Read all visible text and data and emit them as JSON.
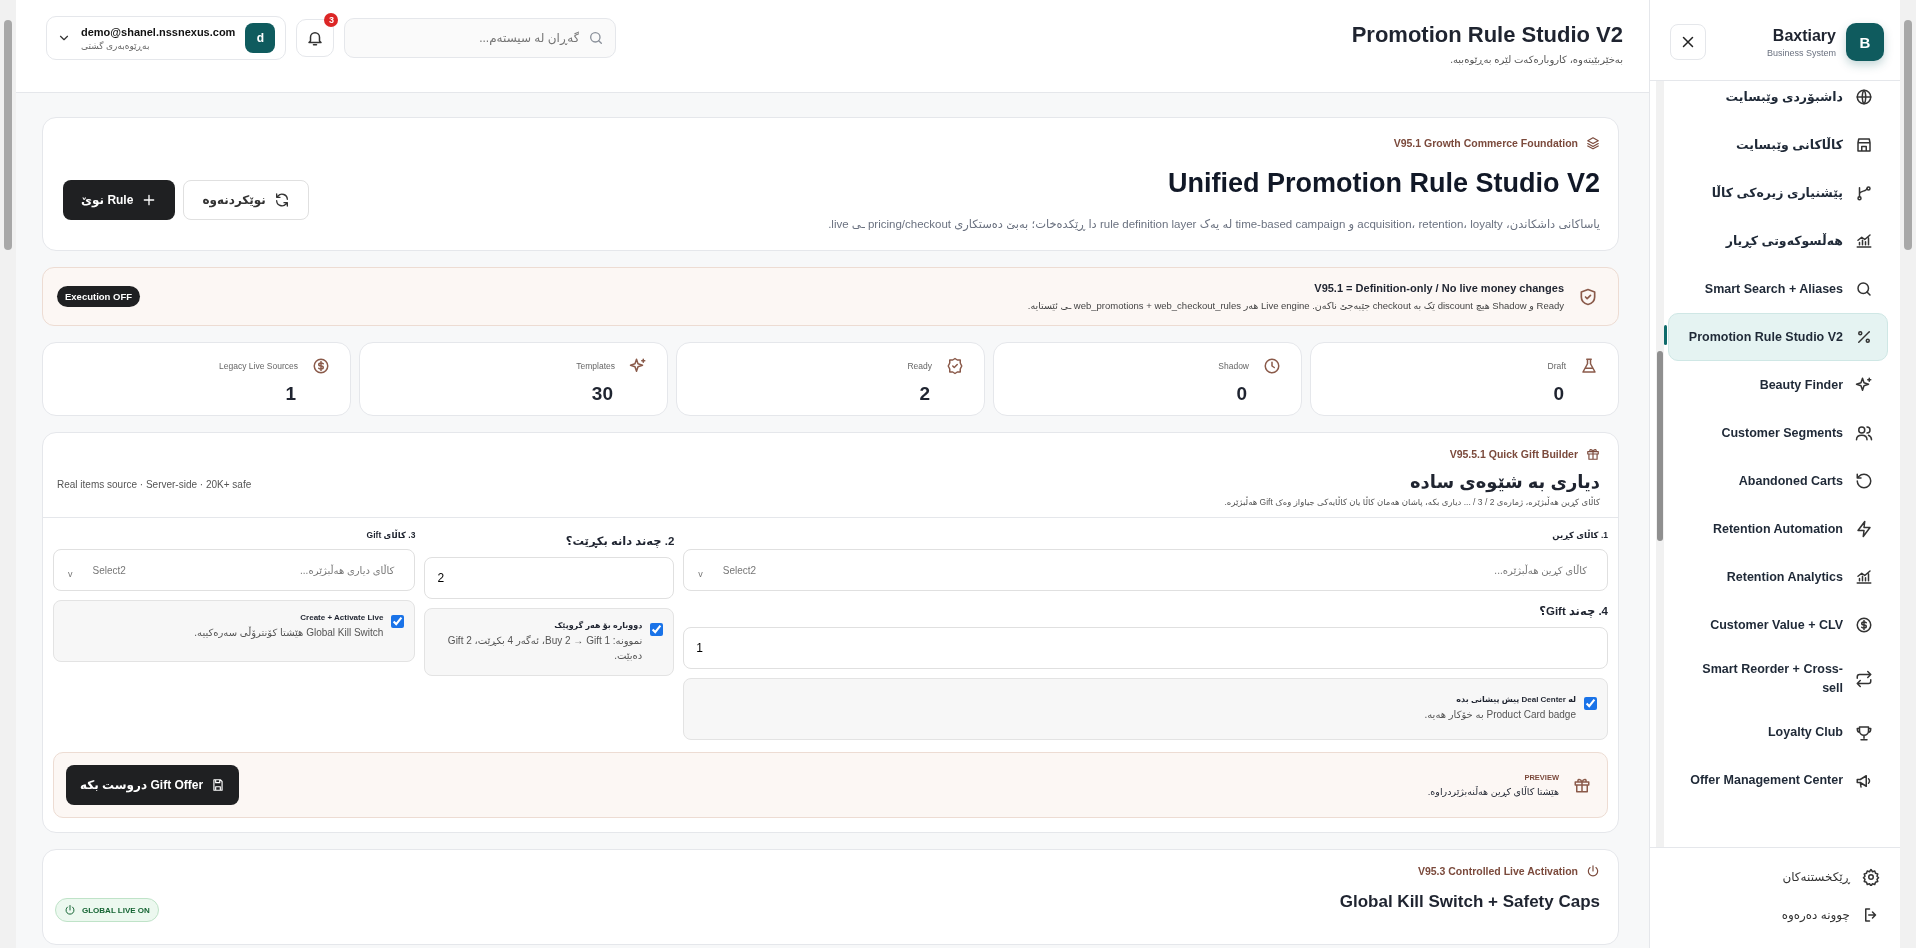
{
  "topbar": {
    "title": "Promotion Rule Studio V2",
    "subtitle": "بەخێربێیتەوە، کاروبارەکەت لێرە بەڕێوەببە.",
    "search": {
      "placeholder": "گەڕان لە سیستەم..."
    },
    "notifications": "3",
    "user": {
      "email": "demo@shanel.nssnexus.com",
      "role": "بەڕێوەبەری گشتی",
      "avatar": "d"
    }
  },
  "header": {
    "eyebrow": "V95.1 Growth Commerce Foundation",
    "title": "Unified Promotion Rule Studio V2",
    "description": "یاساکانی داشکاندن، acquisition، retention، loyalty و time-based campaign لە یەک rule definition layer دا ڕێکدەخات؛ بەبێ دەستکاری pricing/checkout ـی live.",
    "buttons": [
      {
        "label": "نوێکردنەوە",
        "kind": "secondary"
      },
      {
        "label": "Rule نوێ",
        "kind": "primary"
      }
    ]
  },
  "banner": {
    "title": "V95.1 = Definition-only / No live money changes",
    "text": "Ready و Shadow هیچ discount ێک بە checkout جێبەجێ ناکەن. Live engine هەر web_promotions + web_checkout_rules ـی ئێستایە.",
    "badge": "Execution OFF"
  },
  "stats": [
    {
      "label": "Draft",
      "value": "0"
    },
    {
      "label": "Shadow",
      "value": "0"
    },
    {
      "label": "Ready",
      "value": "2"
    },
    {
      "label": "Templates",
      "value": "30"
    },
    {
      "label": "Legacy Live Sources",
      "value": "1"
    }
  ],
  "gift_builder": {
    "eyebrow": "V95.5.1 Quick Gift Builder",
    "title": "دیاری بە شێوەی سادە",
    "description": "کاڵای کڕین هەڵبژێرە، ژمارەی 2 / 3 / ... دیاری بکە، پاشان هەمان کاڵا یان کاڵایەکی جیاواز وەک Gift هەڵبژێرە.",
    "note": "Real items source · Server-side · 20K+ safe",
    "buy_item": {
      "label": "1. کاڵای کڕین",
      "placeholder": "کاڵای کڕین هەڵبژێرە...",
      "tag": "Select2",
      "caret": "v"
    },
    "buy_qty": {
      "label": "2. چەند دانە بکڕێت؟",
      "value": "2"
    },
    "gift_item": {
      "label": "3. کاڵای Gift",
      "placeholder": "کاڵای دیاری هەڵبژێرە...",
      "tag": "Select2",
      "caret": "v"
    },
    "gift_qty": {
      "label": "4. چەند Gift؟",
      "value": "1"
    },
    "deal_center": {
      "title": "لە Deal Center پیش پیشانی بدە",
      "text": "Product Card badge بە خۆکار هەیە.",
      "checked": true
    },
    "repeat": {
      "title": "دووبارە بۆ هەر گروپێک",
      "text": "نموونە: Buy 2 → Gift 1، ئەگەر 4 بکڕێت، Gift 2 دەبێت.",
      "checked": true
    },
    "activate": {
      "title": "Create + Activate Live",
      "text": "Global Kill Switch هێشتا کۆنترۆڵی سەرەکییە.",
      "checked": true
    },
    "preview": {
      "label": "PREVIEW",
      "text": "هێشتا کاڵای کڕین هەڵنەبژێردراوە.",
      "button": "Gift Offer دروست بکە"
    }
  },
  "live_card": {
    "eyebrow": "V95.3 Controlled Live Activation",
    "title": "Global Kill Switch + Safety Caps",
    "badge": "GLOBAL LIVE ON"
  },
  "sidebar": {
    "brand": "Baxtiary",
    "tagline": "Business System",
    "logo": "B",
    "items": [
      {
        "label": "داشبۆردی وێبسایت",
        "selected": false
      },
      {
        "label": "کاڵاکانی وێبسایت",
        "selected": false
      },
      {
        "label": "پێشنیاری زیرەکی کاڵا",
        "selected": false
      },
      {
        "label": "هەڵسوکەوتی کڕیار",
        "selected": false
      },
      {
        "label": "Smart Search + Aliases",
        "selected": false
      },
      {
        "label": "Promotion Rule Studio V2",
        "selected": true
      },
      {
        "label": "Beauty Finder",
        "selected": false
      },
      {
        "label": "Customer Segments",
        "selected": false
      },
      {
        "label": "Abandoned Carts",
        "selected": false
      },
      {
        "label": "Retention Automation",
        "selected": false
      },
      {
        "label": "Retention Analytics",
        "selected": false
      },
      {
        "label": "Customer Value + CLV",
        "selected": false
      },
      {
        "label": "Smart Reorder + Cross-sell",
        "selected": false
      },
      {
        "label": "Loyalty Club",
        "selected": false
      },
      {
        "label": "Offer Management Center",
        "selected": false
      }
    ],
    "footer": [
      {
        "label": "ڕێکخستنەکان"
      },
      {
        "label": "چوونە دەرەوە"
      }
    ]
  }
}
